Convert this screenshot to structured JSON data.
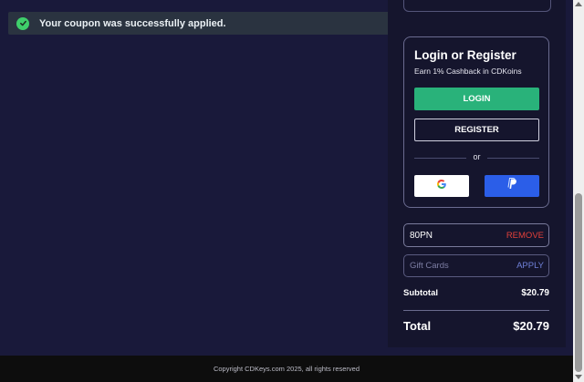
{
  "toast": {
    "message": "Your coupon was successfully applied.",
    "icon": "check-circle-icon",
    "color": "#3fcf6b"
  },
  "login": {
    "title": "Login or Register",
    "subtitle": "Earn 1% Cashback in CDKoins",
    "login_label": "LOGIN",
    "register_label": "REGISTER",
    "or_text": "or",
    "google_icon": "google-icon",
    "paypal_icon": "paypal-icon",
    "accent": "#29b27a"
  },
  "coupon": {
    "code": "80PN",
    "remove_label": "REMOVE"
  },
  "gift": {
    "placeholder": "Gift Cards",
    "apply_label": "APPLY"
  },
  "summary": {
    "subtotal_label": "Subtotal",
    "subtotal_value": "$20.79",
    "total_label": "Total",
    "total_value": "$20.79"
  },
  "footer": {
    "copyright": "Copyright CDKeys.com 2025, all rights reserved"
  }
}
